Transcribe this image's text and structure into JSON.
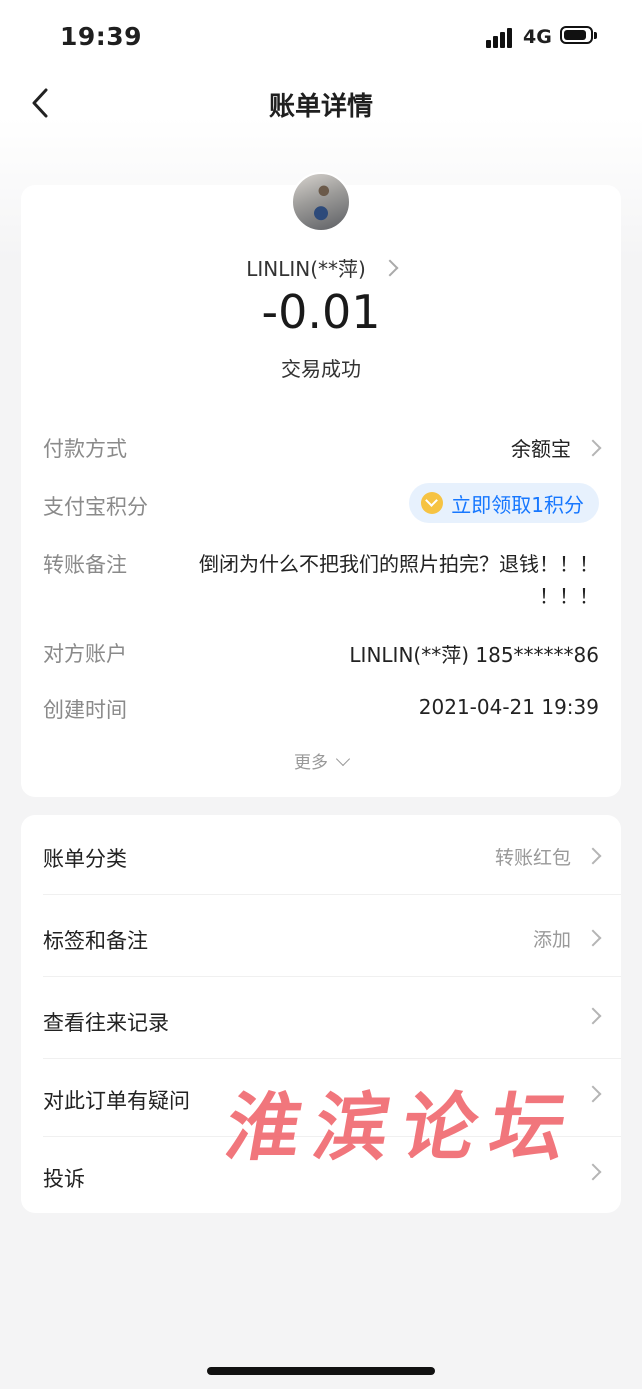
{
  "status_bar": {
    "time": "19:39",
    "network": "4G"
  },
  "nav": {
    "title": "账单详情"
  },
  "summary": {
    "payee": "LINLIN(**萍)",
    "amount": "-0.01",
    "status": "交易成功"
  },
  "details": {
    "payment_method_label": "付款方式",
    "payment_method_value": "余额宝",
    "points_label": "支付宝积分",
    "points_button": "立即领取1积分",
    "memo_label": "转账备注",
    "memo_line1": "倒闭为什么不把我们的照片拍完？退钱！！！",
    "memo_line2": "！！！",
    "counterparty_label": "对方账户",
    "counterparty_value": "LINLIN(**萍) 185******86",
    "created_label": "创建时间",
    "created_value": "2021-04-21 19:39",
    "more": "更多"
  },
  "actions": [
    {
      "label": "账单分类",
      "value": "转账红包"
    },
    {
      "label": "标签和备注",
      "value": "添加"
    },
    {
      "label": "查看往来记录",
      "value": ""
    },
    {
      "label": "对此订单有疑问",
      "value": ""
    },
    {
      "label": "投诉",
      "value": ""
    }
  ],
  "watermark": "淮滨论坛",
  "colors": {
    "accent": "#1677ff",
    "watermark": "#f0686e",
    "coin": "#f6c343"
  }
}
